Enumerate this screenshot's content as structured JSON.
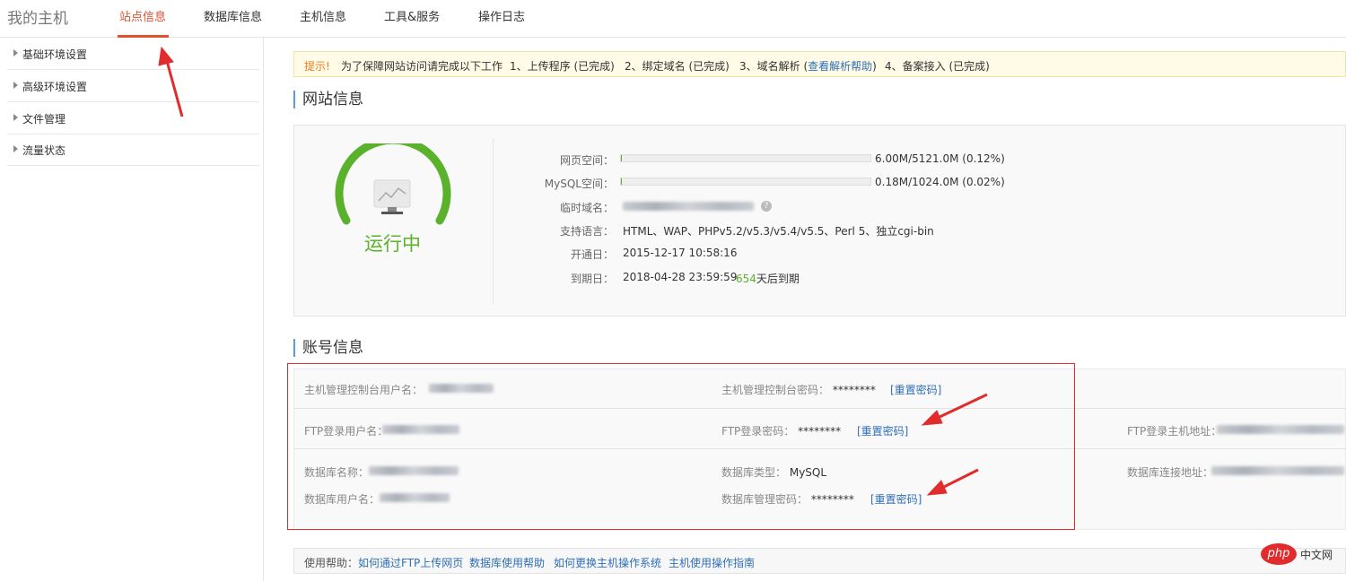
{
  "header": {
    "brand": "我的主机",
    "tabs": [
      {
        "label": "站点信息",
        "active": true
      },
      {
        "label": "数据库信息"
      },
      {
        "label": "主机信息"
      },
      {
        "label": "工具&服务"
      },
      {
        "label": "操作日志"
      }
    ]
  },
  "sidebar": {
    "items": [
      {
        "label": "基础环境设置"
      },
      {
        "label": "高级环境设置"
      },
      {
        "label": "文件管理"
      },
      {
        "label": "流量状态"
      }
    ]
  },
  "notice": {
    "tip": "提示!",
    "text": "为了保障网站访问请完成以下工作",
    "step1": "1、上传程序 (已完成)",
    "step2": "2、绑定域名 (已完成)",
    "step3_prefix": "3、域名解析 (",
    "step3_link": "查看解析帮助",
    "step3_suffix": ")",
    "step4": "4、备案接入 (已完成)"
  },
  "site_info": {
    "title": "网站信息",
    "status": "运行中",
    "web_space_label": "网页空间：",
    "web_space_value": "6.00M/5121.0M (0.12%)",
    "web_space_ratio": 0.0012,
    "mysql_space_label": "MySQL空间：",
    "mysql_space_value": "0.18M/1024.0M (0.02%)",
    "mysql_space_ratio": 0.0002,
    "temp_domain_label": "临时域名：",
    "languages_label": "支持语言：",
    "languages_value": "HTML、WAP、PHPv5.2/v5.3/v5.4/v5.5、Perl 5、独立cgi-bin",
    "open_date_label": "开通日：",
    "open_date_value": "2015-12-17 10:58:16",
    "expire_date_label": "到期日：",
    "expire_date_value": "2018-04-28 23:59:59",
    "days_left": "654",
    "days_suffix": "天后到期"
  },
  "account_info": {
    "title": "账号信息",
    "panel_user_label": "主机管理控制台用户名：",
    "panel_pwd_label": "主机管理控制台密码：",
    "panel_pwd_value": "********",
    "reset_label": "[重置密码]",
    "ftp_user_label": "FTP登录用户名：",
    "ftp_pwd_label": "FTP登录密码：",
    "ftp_pwd_value": "********",
    "ftp_host_label": "FTP登录主机地址：",
    "db_name_label": "数据库名称：",
    "db_type_label": "数据库类型：",
    "db_type_value": "MySQL",
    "db_host_label": "数据库连接地址：",
    "db_user_label": "数据库用户名：",
    "db_pwd_label": "数据库管理密码：",
    "db_pwd_value": "********"
  },
  "help": {
    "label": "使用帮助：",
    "links": [
      "如何通过FTP上传网页",
      "数据库使用帮助",
      "如何更换主机操作系统",
      "主机使用操作指南"
    ]
  },
  "watermark": {
    "logo": "php",
    "text": "中文网"
  },
  "colors": {
    "accent": "#e0512f",
    "status_green": "#5ab22c",
    "link_blue": "#2e6fb8",
    "annotation_red": "#e02c2c"
  }
}
